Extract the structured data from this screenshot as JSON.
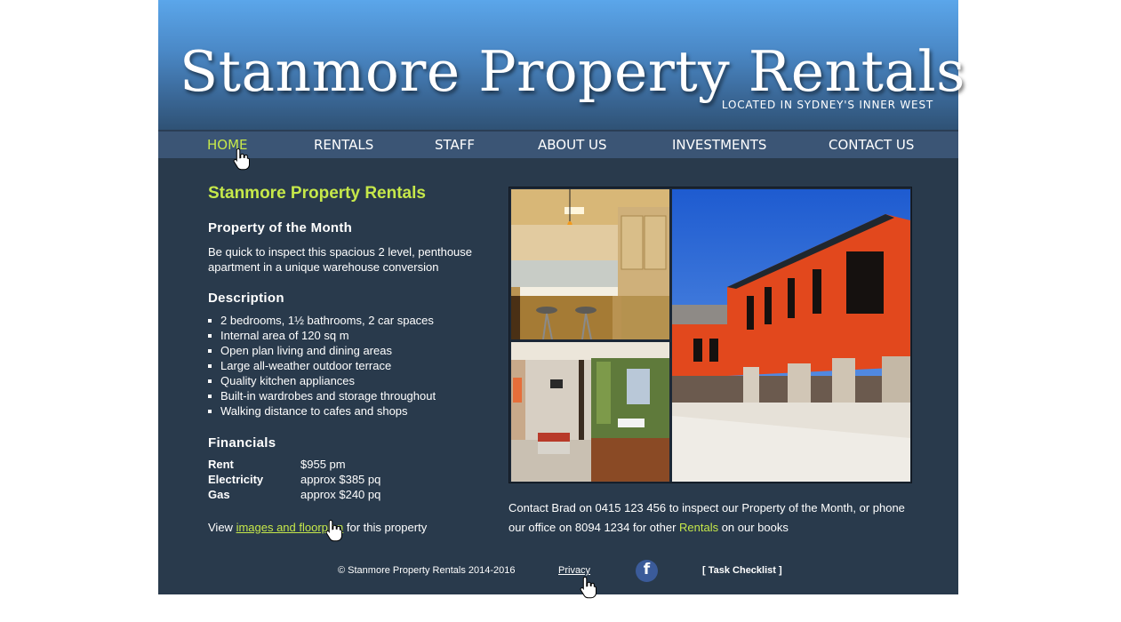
{
  "header": {
    "title": "Stanmore Property Rentals",
    "tagline": "LOCATED IN SYDNEY'S INNER WEST"
  },
  "nav": {
    "items": [
      {
        "label": "HOME",
        "active": true
      },
      {
        "label": "RENTALS",
        "active": false
      },
      {
        "label": "STAFF",
        "active": false
      },
      {
        "label": "ABOUT US",
        "active": false
      },
      {
        "label": "INVESTMENTS",
        "active": false
      },
      {
        "label": "CONTACT US",
        "active": false
      }
    ]
  },
  "main": {
    "heading": "Stanmore Property Rentals",
    "property_of_month": {
      "heading": "Property of the Month",
      "text": "Be quick to inspect this spacious 2 level, penthouse apartment in a unique warehouse conversion"
    },
    "description": {
      "heading": "Description",
      "items": [
        "2 bedrooms, 1½ bathrooms, 2 car spaces",
        "Internal area of 120 sq m",
        "Open plan living and dining areas",
        "Large all-weather outdoor terrace",
        "Quality kitchen appliances",
        "Built-in wardrobes and storage throughout",
        "Walking distance to cafes and shops"
      ]
    },
    "financials": {
      "heading": "Financials",
      "rows": [
        {
          "label": "Rent",
          "value": "$955 pm"
        },
        {
          "label": "Electricity",
          "value": "approx $385 pq"
        },
        {
          "label": "Gas",
          "value": "approx $240 pq"
        }
      ]
    },
    "view_line": {
      "prefix": "View ",
      "link": "images and floorplan",
      "suffix": " for this property"
    },
    "contact": {
      "text_before": "Contact Brad on 0415 123 456 to inspect our Property of the Month, or phone our office on 8094 1234 for other ",
      "link": "Rentals",
      "text_after": " on our books"
    }
  },
  "footer": {
    "copyright": "© Stanmore Property Rentals 2014-2016",
    "privacy": "Privacy",
    "task_checklist": "[ Task Checklist ]",
    "facebook_glyph": "f"
  },
  "colors": {
    "accent": "#c6e84a",
    "background": "#293a4c",
    "header_top": "#5ba6ea",
    "facebook": "#3b5b9a"
  },
  "icons": [
    "hand-pointer-cursor-icon",
    "facebook-icon"
  ]
}
